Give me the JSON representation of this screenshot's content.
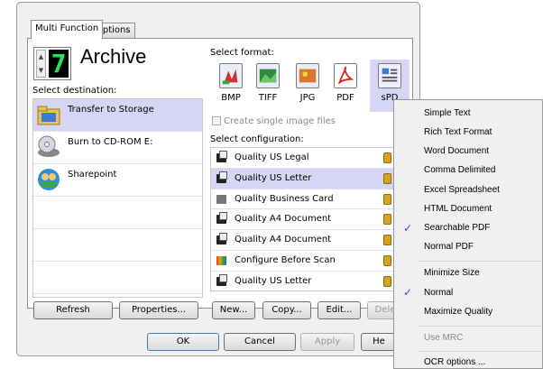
{
  "tabs": {
    "multi_function": "Multi Function",
    "options": "Options"
  },
  "counter": {
    "digit": "7",
    "up": "▲",
    "down": "▼"
  },
  "title": "Archive",
  "select_destination": "Select destination:",
  "destinations": [
    {
      "label": "Transfer to Storage",
      "icon": "folder-storage-icon",
      "selected": true
    },
    {
      "label": "Burn to CD-ROM  E:",
      "icon": "cd-rom-icon",
      "selected": false
    },
    {
      "label": "Sharepoint",
      "icon": "sharepoint-icon",
      "selected": false
    }
  ],
  "select_format": "Select format:",
  "formats": [
    {
      "label": "BMP",
      "icon": "bmp-icon",
      "selected": false
    },
    {
      "label": "TIFF",
      "icon": "tiff-icon",
      "selected": false
    },
    {
      "label": "JPG",
      "icon": "jpg-icon",
      "selected": false
    },
    {
      "label": "PDF",
      "icon": "pdf-icon",
      "selected": false
    },
    {
      "label": "sPD",
      "icon": "spdf-icon",
      "selected": true
    }
  ],
  "create_single": "Create single image files",
  "select_configuration": "Select configuration:",
  "configurations": [
    {
      "label": "Quality US Legal",
      "selected": false
    },
    {
      "label": "Quality US Letter",
      "selected": true
    },
    {
      "label": "Quality Business Card",
      "selected": false
    },
    {
      "label": "Quality A4 Document",
      "selected": false
    },
    {
      "label": "Quality A4 Document",
      "selected": false
    },
    {
      "label": "Configure Before Scan",
      "selected": false
    },
    {
      "label": "Quality US Letter",
      "selected": false
    }
  ],
  "buttons": {
    "refresh": "Refresh",
    "properties": "Properties...",
    "new": "New...",
    "copy": "Copy...",
    "edit": "Edit...",
    "delete": "Dele",
    "ok": "OK",
    "cancel": "Cancel",
    "apply": "Apply",
    "help": "He"
  },
  "context_menu": {
    "simple_text": "Simple Text",
    "rich_text": "Rich Text Format",
    "word": "Word Document",
    "comma": "Comma Delimited",
    "excel": "Excel Spreadsheet",
    "html": "HTML Document",
    "searchable_pdf": "Searchable PDF",
    "normal_pdf": "Normal PDF",
    "minimize": "Minimize Size",
    "normal": "Normal",
    "maximize": "Maximize Quality",
    "use_mrc": "Use MRC",
    "ocr_options": "OCR options ...",
    "check": "✓"
  },
  "colors": {
    "selection": "#d6d6f4",
    "lcd": "#2fe05a",
    "check": "#1a5fb4"
  }
}
